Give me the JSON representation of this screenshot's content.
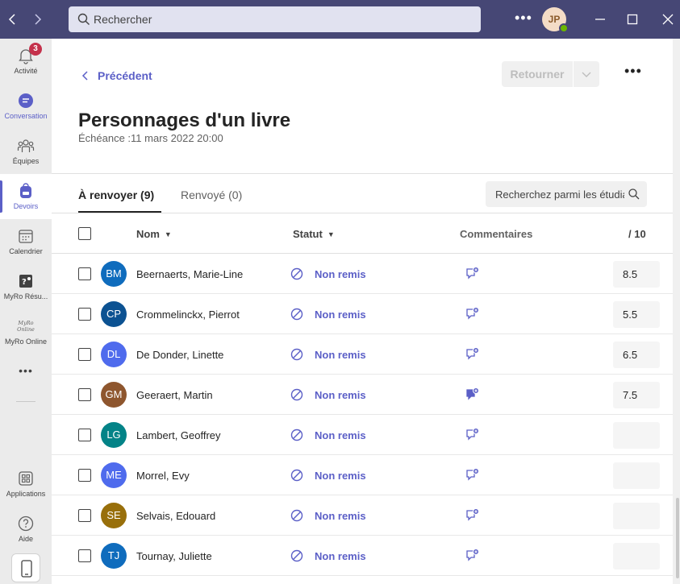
{
  "search": {
    "placeholder": "Rechercher"
  },
  "user": {
    "initials": "JP"
  },
  "rail": [
    {
      "label": "Activité",
      "badge": "3"
    },
    {
      "label": "Conversation"
    },
    {
      "label": "Équipes"
    },
    {
      "label": "Devoirs"
    },
    {
      "label": "Calendrier"
    },
    {
      "label": "MyRo Résu..."
    },
    {
      "label": "MyRo Online",
      "logo_text": "MyRo Online"
    },
    {
      "label": "Applications"
    },
    {
      "label": "Aide"
    }
  ],
  "header": {
    "back_label": "Précédent",
    "return_label": "Retourner",
    "title": "Personnages d'un livre",
    "due": "Échéance :11 mars 2022 20:00"
  },
  "tabs": [
    {
      "label": "À renvoyer (9)"
    },
    {
      "label": "Renvoyé (0)"
    }
  ],
  "student_search": {
    "placeholder": "Recherchez parmi les étudiants"
  },
  "columns": {
    "name": "Nom",
    "status": "Statut",
    "comments": "Commentaires",
    "points": "/ 10"
  },
  "students": [
    {
      "initials": "BM",
      "name": "Beernaerts, Marie-Line",
      "status": "Non remis",
      "grade": "8.5",
      "color": "#0f6cbd",
      "has_comment": false
    },
    {
      "initials": "CP",
      "name": "Crommelinckx, Pierrot",
      "status": "Non remis",
      "grade": "5.5",
      "color": "#0c5292",
      "has_comment": false
    },
    {
      "initials": "DL",
      "name": "De Donder, Linette",
      "status": "Non remis",
      "grade": "6.5",
      "color": "#4f6bed",
      "has_comment": false
    },
    {
      "initials": "GM",
      "name": "Geeraert, Martin",
      "status": "Non remis",
      "grade": "7.5",
      "color": "#8e562e",
      "has_comment": true
    },
    {
      "initials": "LG",
      "name": "Lambert, Geoffrey",
      "status": "Non remis",
      "grade": "",
      "color": "#038387",
      "has_comment": false
    },
    {
      "initials": "ME",
      "name": "Morrel, Evy",
      "status": "Non remis",
      "grade": "",
      "color": "#4f6bed",
      "has_comment": false
    },
    {
      "initials": "SE",
      "name": "Selvais, Edouard",
      "status": "Non remis",
      "grade": "",
      "color": "#986f0b",
      "has_comment": false
    },
    {
      "initials": "TJ",
      "name": "Tournay, Juliette",
      "status": "Non remis",
      "grade": "",
      "color": "#0f6cbd",
      "has_comment": false
    }
  ],
  "colors": {
    "brand": "#464775",
    "accent": "#5b5fc7"
  }
}
